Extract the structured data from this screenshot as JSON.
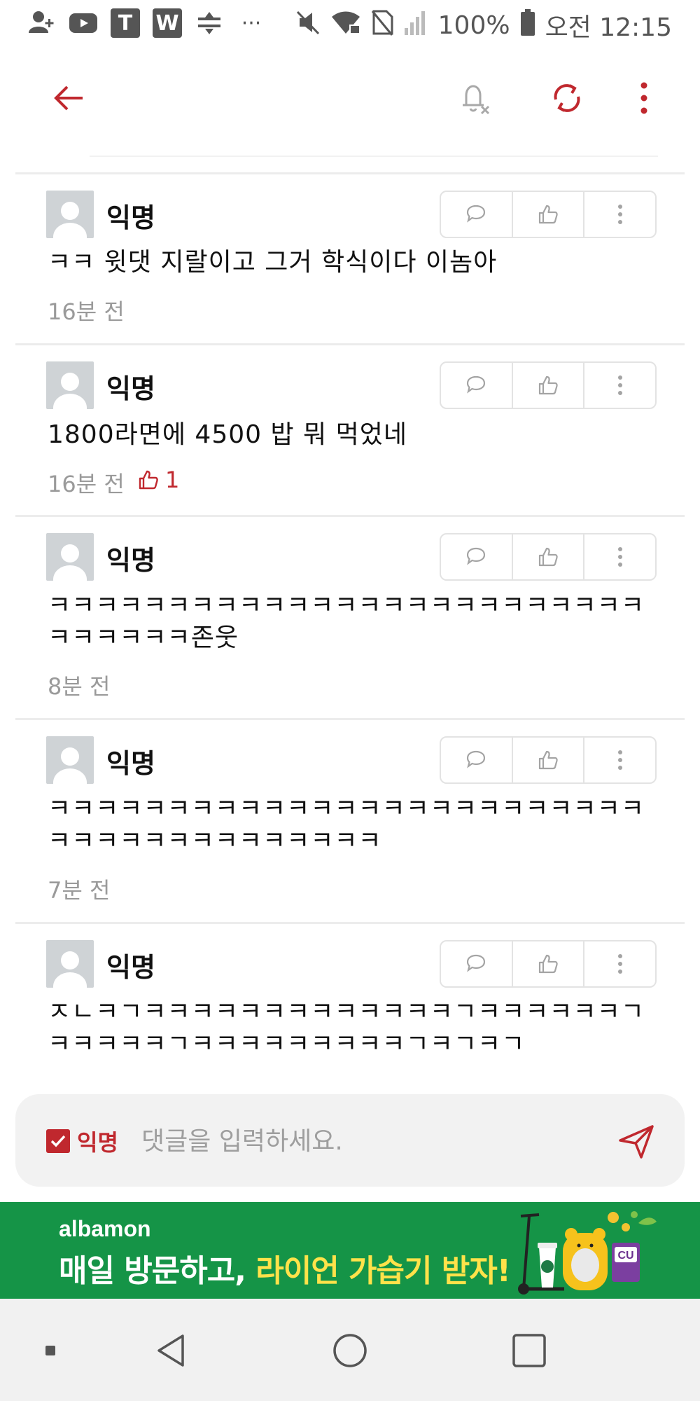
{
  "status_bar": {
    "left_icons": [
      "add-person-icon",
      "youtube-icon",
      "t-app-icon",
      "w-app-icon",
      "data-saver-icon",
      "more-dots-icon"
    ],
    "t_label": "T",
    "w_label": "W",
    "more_label": "···",
    "right_icons": [
      "mute-icon",
      "wifi-locked-icon",
      "no-sim-icon",
      "signal-icon",
      "battery-icon"
    ],
    "battery_percent": "100%",
    "time": "오전 12:15"
  },
  "app_bar": {
    "back": "back-arrow-icon",
    "notification": "bell-off-icon",
    "refresh": "refresh-icon",
    "more": "more-vertical-icon"
  },
  "comments": [
    {
      "author": "익명",
      "text": "ㅋㅋ 윗댓 지랄이고 그거 학식이다 이놈아",
      "time": "16분 전",
      "likes": ""
    },
    {
      "author": "익명",
      "text": "1800라면에 4500 밥 뭐 먹었네",
      "time": "16분 전",
      "likes": "1"
    },
    {
      "author": "익명",
      "text": "ㅋㅋㅋㅋㅋㅋㅋㅋㅋㅋㅋㅋㅋㅋㅋㅋㅋㅋㅋㅋㅋㅋㅋㅋㅋㅋㅋㅋㅋㅋㅋ존웃",
      "time": "8분 전",
      "likes": ""
    },
    {
      "author": "익명",
      "text": "ㅋㅋㅋㅋㅋㅋㅋㅋㅋㅋㅋㅋㅋㅋㅋㅋㅋㅋㅋㅋㅋㅋㅋㅋㅋㅋㅋㅋㅋㅋㅋㅋㅋㅋㅋㅋㅋㅋㅋ",
      "time": "7분 전",
      "likes": ""
    },
    {
      "author": "익명",
      "text": "ㅈㄴㅋㄱㅋㅋㅋㅋㅋㅋㅋㅋㅋㅋㅋㅋㅋㄱㅋㅋㅋㅋㅋㅋㄱㅋㅋㅋㅋㅋㄱㅋㅋㅋㅋㅋㅋㅋㅋㅋㄱㅋㄱㅋㄱ",
      "time": "",
      "likes": ""
    }
  ],
  "comment_actions": [
    "reply-icon",
    "thumbs-up-icon",
    "more-vertical-icon"
  ],
  "input_bar": {
    "anon_label": "익명",
    "anon_checked": true,
    "placeholder": "댓글을 입력하세요.",
    "send": "send-icon"
  },
  "ad": {
    "brand": "albamon",
    "line_main": "매일 방문하고, ",
    "line_highlight": "라이언 가습기 받자!",
    "coupon_label": "CU",
    "bg_color": "#159447",
    "highlight_color": "#ffe24a"
  },
  "nav_bar": {
    "buttons": [
      "recent-apps-dot-icon",
      "back-triangle-icon",
      "home-circle-icon",
      "overview-square-icon"
    ]
  },
  "colors": {
    "accent": "#c0282e",
    "muted_text": "#9a9a9a"
  }
}
